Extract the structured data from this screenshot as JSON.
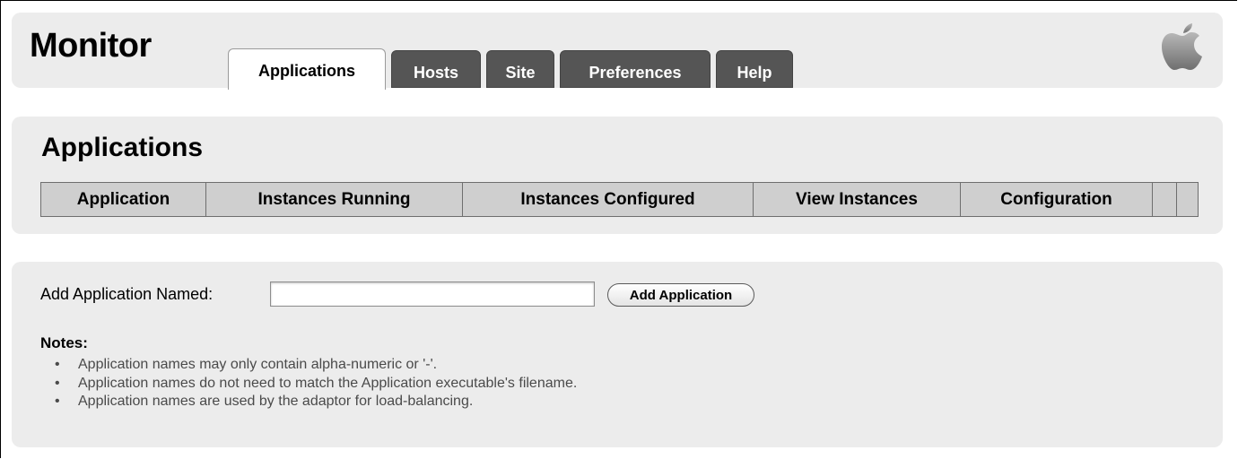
{
  "header": {
    "title": "Monitor",
    "tabs": [
      {
        "label": "Applications",
        "active": true
      },
      {
        "label": "Hosts",
        "active": false
      },
      {
        "label": "Site",
        "active": false
      },
      {
        "label": "Preferences",
        "active": false
      },
      {
        "label": "Help",
        "active": false
      }
    ],
    "logo_icon": "apple-logo-icon"
  },
  "applications": {
    "title": "Applications",
    "columns": [
      "Application",
      "Instances Running",
      "Instances Configured",
      "View Instances",
      "Configuration",
      "",
      ""
    ]
  },
  "add_application": {
    "label": "Add Application Named:",
    "input_value": "",
    "button_label": "Add Application"
  },
  "notes": {
    "title": "Notes:",
    "items": [
      "Application names may only contain alpha-numeric or '-'.",
      "Application names do not need to match the Application executable's filename.",
      "Application names are used by the adaptor for load-balancing."
    ]
  },
  "colors": {
    "panel": "#ececec",
    "tab_inactive": "#555555",
    "table_header": "#cfcfcf"
  }
}
